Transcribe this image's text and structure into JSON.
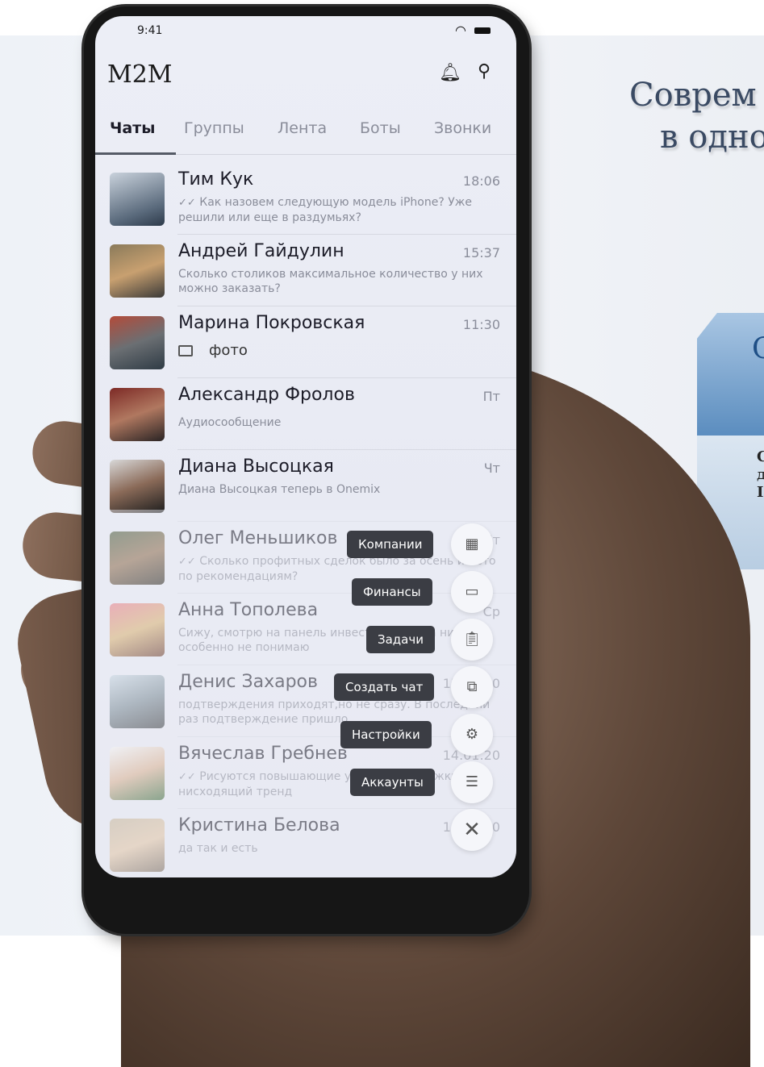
{
  "background": {
    "headline_line1": "Соврем",
    "headline_line2": "в одно",
    "panel_letter": "С",
    "panel_line1": "С",
    "panel_line2": "д",
    "panel_line3": "I"
  },
  "status_bar": {
    "time": "9:41"
  },
  "app": {
    "title": "M2M",
    "icons": {
      "bell": "bell-icon",
      "search": "search-icon"
    },
    "tabs": [
      {
        "label": "Чаты",
        "active": true
      },
      {
        "label": "Группы"
      },
      {
        "label": "Лента"
      },
      {
        "label": "Боты"
      },
      {
        "label": "Звонки"
      }
    ],
    "chats": [
      {
        "name": "Тим Кук",
        "time": "18:06",
        "check": "✓✓",
        "preview": "Как назовем следующую модель iPhone? Уже решили или еще в раздумьях?"
      },
      {
        "name": "Андрей Гайдулин",
        "time": "15:37",
        "preview": "Сколько столиков максимальное количество у них можно заказать?"
      },
      {
        "name": "Марина Покровская",
        "time": "11:30",
        "preview": "фото"
      },
      {
        "name": "Александр Фролов",
        "time": "Пт",
        "preview": "Аудиосообщение"
      },
      {
        "name": "Диана Высоцкая",
        "time": "Чт",
        "preview": "Диана Высоцкая теперь в Onemix"
      },
      {
        "name": "Олег Меньшиков",
        "time": "Чт",
        "check": "✓✓",
        "preview": "Сколько профитных сделок было за осень и лето по рекомендациям?"
      },
      {
        "name": "Анна Тополева",
        "time": "Ср",
        "preview": "Сижу, смотрю на панель инвестиций, пока ничего особенно не понимаю"
      },
      {
        "name": "Денис Захаров",
        "time": "15.01.20",
        "preview": "подтверждения приходят,но не сразу. В последний раз подтверждение пришло."
      },
      {
        "name": "Вячеслав Гребнев",
        "time": "14.01.20",
        "check": "✓✓",
        "preview": "Рисуются повышающие уровни поддержки, нисходящий тренд"
      },
      {
        "name": "Кристина Белова",
        "time": "13.01.20",
        "preview": "да так и есть"
      }
    ],
    "fab_menu": [
      {
        "label": "Компании",
        "icon": "building-icon"
      },
      {
        "label": "Финансы",
        "icon": "money-icon"
      },
      {
        "label": "Задачи",
        "icon": "clipboard-icon"
      },
      {
        "label": "Создать чат",
        "icon": "new-chat-icon"
      },
      {
        "label": "Настройки",
        "icon": "gear-icon"
      },
      {
        "label": "Аккаунты",
        "icon": "accounts-icon"
      }
    ],
    "fab_close_icon": "close-icon"
  }
}
